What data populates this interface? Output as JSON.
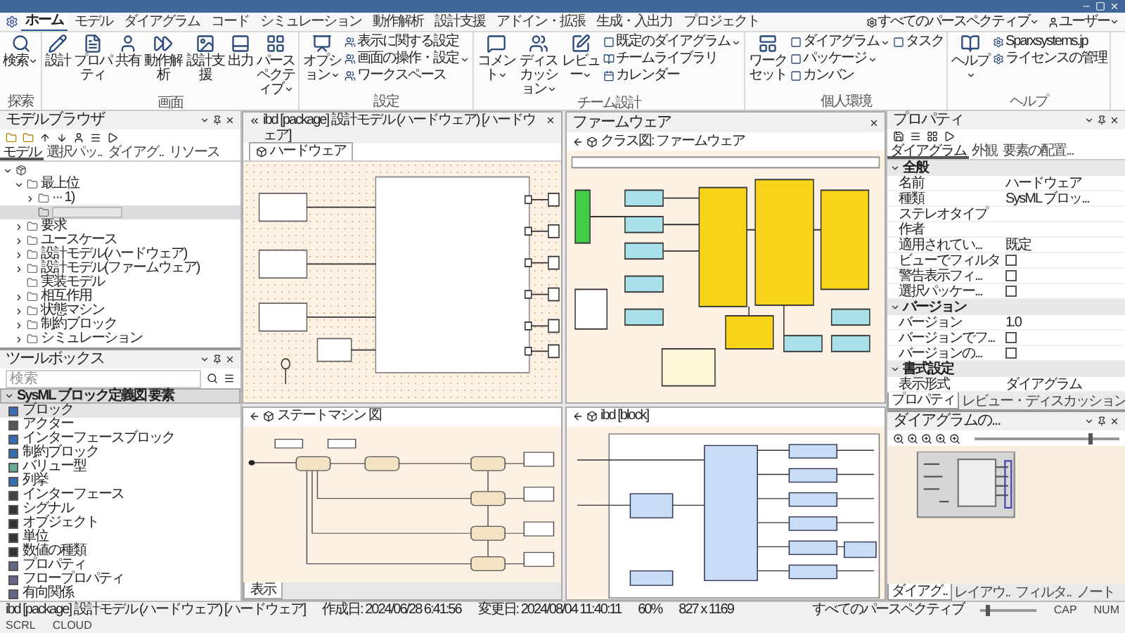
{
  "ribbon": {
    "tabs": [
      {
        "label": "ホーム",
        "selected": true
      },
      {
        "label": "モデル",
        "selected": false
      },
      {
        "label": "ダイアグラム",
        "selected": false
      },
      {
        "label": "コード",
        "selected": false
      },
      {
        "label": "シミュレーション",
        "selected": false
      },
      {
        "label": "動作解析",
        "selected": false
      },
      {
        "label": "設計支援",
        "selected": false
      },
      {
        "label": "アドイン・拡張",
        "selected": false
      },
      {
        "label": "生成・入出力",
        "selected": false
      },
      {
        "label": "プロジェクト",
        "selected": false
      }
    ],
    "perspective": {
      "label": "すべてのパースペクティブ",
      "dropdown": true
    },
    "user": {
      "label": "ユーザー",
      "dropdown": true
    },
    "groups": [
      {
        "label": "探索",
        "items": [
          {
            "kind": "large",
            "label": "検索",
            "dropdown": true
          }
        ]
      },
      {
        "label": "画面",
        "items": [
          {
            "kind": "large",
            "label": "設計",
            "dropdown": false
          },
          {
            "kind": "large",
            "label": "プロパティ",
            "dropdown": false
          },
          {
            "kind": "large",
            "label": "共有",
            "dropdown": false
          },
          {
            "kind": "large",
            "label": "動作解析",
            "dropdown": false
          },
          {
            "kind": "large",
            "label": "設計支援",
            "dropdown": false
          },
          {
            "kind": "large",
            "label": "出力",
            "dropdown": false
          },
          {
            "kind": "large",
            "label": "パースペクティブ",
            "dropdown": true
          }
        ]
      },
      {
        "label": "設定",
        "items": [
          {
            "kind": "large",
            "label": "オプション",
            "dropdown": true
          },
          {
            "kind": "small",
            "label": "表示に関する設定",
            "dropdown": false
          },
          {
            "kind": "small",
            "label": "画面の操作・設定",
            "dropdown": true
          },
          {
            "kind": "small",
            "label": "ワークスペース",
            "dropdown": false
          }
        ]
      },
      {
        "label": "チーム設計",
        "items": [
          {
            "kind": "large",
            "label": "コメント",
            "dropdown": true
          },
          {
            "kind": "large",
            "label": "ディスカッション",
            "dropdown": true
          },
          {
            "kind": "large",
            "label": "レビュー",
            "dropdown": true
          },
          {
            "kind": "small",
            "label": "既定のダイアグラム",
            "dropdown": true
          },
          {
            "kind": "small",
            "label": "チームライブラリ",
            "dropdown": false
          },
          {
            "kind": "small",
            "label": "カレンダー",
            "dropdown": false
          }
        ]
      },
      {
        "label": "個人環境",
        "items": [
          {
            "kind": "large",
            "label": "ワークセット",
            "dropdown": false
          },
          {
            "kind": "small",
            "label": "ダイアグラム",
            "dropdown": true
          },
          {
            "kind": "small",
            "label": "パッケージ",
            "dropdown": true
          },
          {
            "kind": "small",
            "label": "カンバン",
            "dropdown": false
          },
          {
            "kind": "small",
            "label": "タスク",
            "dropdown": false
          }
        ]
      },
      {
        "label": "ヘルプ",
        "items": [
          {
            "kind": "large",
            "label": "ヘルプ",
            "dropdown": true
          },
          {
            "kind": "small",
            "label": "Sparxsystems.jp",
            "dropdown": false
          },
          {
            "kind": "small",
            "label": "ライセンスの管理",
            "dropdown": false
          }
        ]
      }
    ]
  },
  "model_browser": {
    "title": "モデルブラウザ",
    "tabs": [
      {
        "label": "モデル",
        "selected": true
      },
      {
        "label": "選択パッ..",
        "selected": false
      },
      {
        "label": "ダイアグ..",
        "selected": false
      },
      {
        "label": "リソース",
        "selected": false
      }
    ],
    "tree": [
      {
        "kind": "root",
        "expanded": true,
        "selected": false,
        "children": [
          {
            "kind": "folder",
            "label": "最上位",
            "expanded": true,
            "selected": false,
            "children": [
              {
                "kind": "folder",
                "label": "··· 1)",
                "expanded": false,
                "selected": false
              },
              {
                "kind": "editing",
                "selected": true
              }
            ]
          },
          {
            "kind": "folder",
            "label": "要求",
            "expanded": false,
            "selected": false
          },
          {
            "kind": "folder",
            "label": "ユースケース",
            "expanded": false,
            "selected": false
          },
          {
            "kind": "folder",
            "label": "設計モデル(ハードウェア)",
            "expanded": false,
            "selected": false
          },
          {
            "kind": "folder",
            "label": "設計モデル(ファームウェア)",
            "expanded": false,
            "selected": false
          },
          {
            "kind": "leaf",
            "label": "実装モデル",
            "selected": false
          },
          {
            "kind": "folder",
            "label": "相互作用",
            "expanded": false,
            "selected": false
          },
          {
            "kind": "folder",
            "label": "状態マシン",
            "expanded": false,
            "selected": false
          },
          {
            "kind": "folder",
            "label": "制約ブロック",
            "expanded": false,
            "selected": false
          },
          {
            "kind": "folder",
            "label": "シミュレーション",
            "expanded": false,
            "selected": false
          }
        ]
      }
    ]
  },
  "toolbox": {
    "title": "ツールボックス",
    "search": {
      "placeholder": "検索"
    },
    "section": {
      "label": "SysML ブロック定義図 要素",
      "expanded": true
    },
    "items": [
      {
        "label": "ブロック",
        "selected": true
      },
      {
        "label": "アクター",
        "selected": false
      },
      {
        "label": "インターフェースブロック",
        "selected": false
      },
      {
        "label": "制約ブロック",
        "selected": false
      },
      {
        "label": "バリュー型",
        "selected": false
      },
      {
        "label": "列挙",
        "selected": false
      },
      {
        "label": "インターフェース",
        "selected": false
      },
      {
        "label": "シグナル",
        "selected": false
      },
      {
        "label": "オブジェクト",
        "selected": false
      },
      {
        "label": "単位",
        "selected": false
      },
      {
        "label": "数値の種類",
        "selected": false
      },
      {
        "label": "プロパティ",
        "selected": false
      },
      {
        "label": "フロープロパティ",
        "selected": false
      },
      {
        "label": "有向関係",
        "selected": false
      }
    ]
  },
  "hardware_view": {
    "header": "ibd [package] 設計モデル (ハードウェア) [ハードウェア]",
    "tabs": [
      {
        "label": "ハードウェア",
        "selected": true
      }
    ]
  },
  "firmware_view": {
    "title": "ファームウェア",
    "breadcrumb": "クラス図: ファームウェア"
  },
  "state_machine_view": {
    "breadcrumb": "ステートマシン 図",
    "tabs": [
      {
        "label": "表示",
        "selected": true
      }
    ]
  },
  "ibd_view": {
    "breadcrumb": "ibd [block]"
  },
  "properties": {
    "title": "プロパティ",
    "tabs": [
      {
        "label": "ダイアグラム",
        "selected": true
      },
      {
        "label": "外観",
        "selected": false
      },
      {
        "label": "要素の配置...",
        "selected": false
      }
    ],
    "sections": [
      {
        "title": "全般",
        "expanded": true,
        "rows": [
          {
            "kind": "text",
            "name": "名前",
            "value": "ハードウェア"
          },
          {
            "kind": "text",
            "name": "種類",
            "value": "SysML ブロッ..."
          },
          {
            "kind": "text",
            "name": "ステレオタイプ"
          },
          {
            "kind": "text",
            "name": "作者"
          },
          {
            "kind": "text",
            "name": "適用されてい...",
            "value": "既定"
          },
          {
            "kind": "checkbox",
            "name": "ビューでフィルタ",
            "checked": false
          },
          {
            "kind": "checkbox",
            "name": "警告表示フィ...",
            "checked": false
          },
          {
            "kind": "checkbox",
            "name": "選択パッケー...",
            "checked": false
          }
        ]
      },
      {
        "title": "バージョン",
        "expanded": true,
        "rows": [
          {
            "kind": "text",
            "name": "バージョン",
            "value": "1.0"
          },
          {
            "kind": "checkbox",
            "name": "バージョンでフ...",
            "checked": false
          },
          {
            "kind": "checkbox",
            "name": "バージョンの...",
            "checked": false
          }
        ]
      },
      {
        "title": "書式設定",
        "expanded": true,
        "rows": [
          {
            "kind": "text",
            "name": "表示形式",
            "value": "ダイアグラム"
          }
        ]
      }
    ],
    "bottom_tabs": [
      {
        "label": "プロパティ",
        "selected": true
      },
      {
        "label": "レビュー・ディスカッション",
        "selected": false
      }
    ]
  },
  "overview": {
    "title": "ダイアグラムの...",
    "zoom_slider": {
      "level": 0.8
    },
    "bottom_tabs": [
      {
        "label": "ダイアグ..",
        "selected": true
      },
      {
        "label": "レイアウ..",
        "selected": false
      },
      {
        "label": "フィルタ..",
        "selected": false
      },
      {
        "label": "ノート",
        "selected": false
      }
    ]
  },
  "status_bar": {
    "document": "ibd [package] 設計モデル (ハードウェア) [ハードウェア]",
    "created": "作成日: 2024/06/28 6:41:56",
    "modified": "変更日: 2024/08/04 11:40:11",
    "zoom": "60%",
    "page_size": "827 x 1169",
    "perspective": "すべてのパースペクティブ",
    "zoom_slider": {
      "level": 0.1
    },
    "indicators": [
      "CAP",
      "NUM",
      "SCRL",
      "CLOUD"
    ]
  }
}
